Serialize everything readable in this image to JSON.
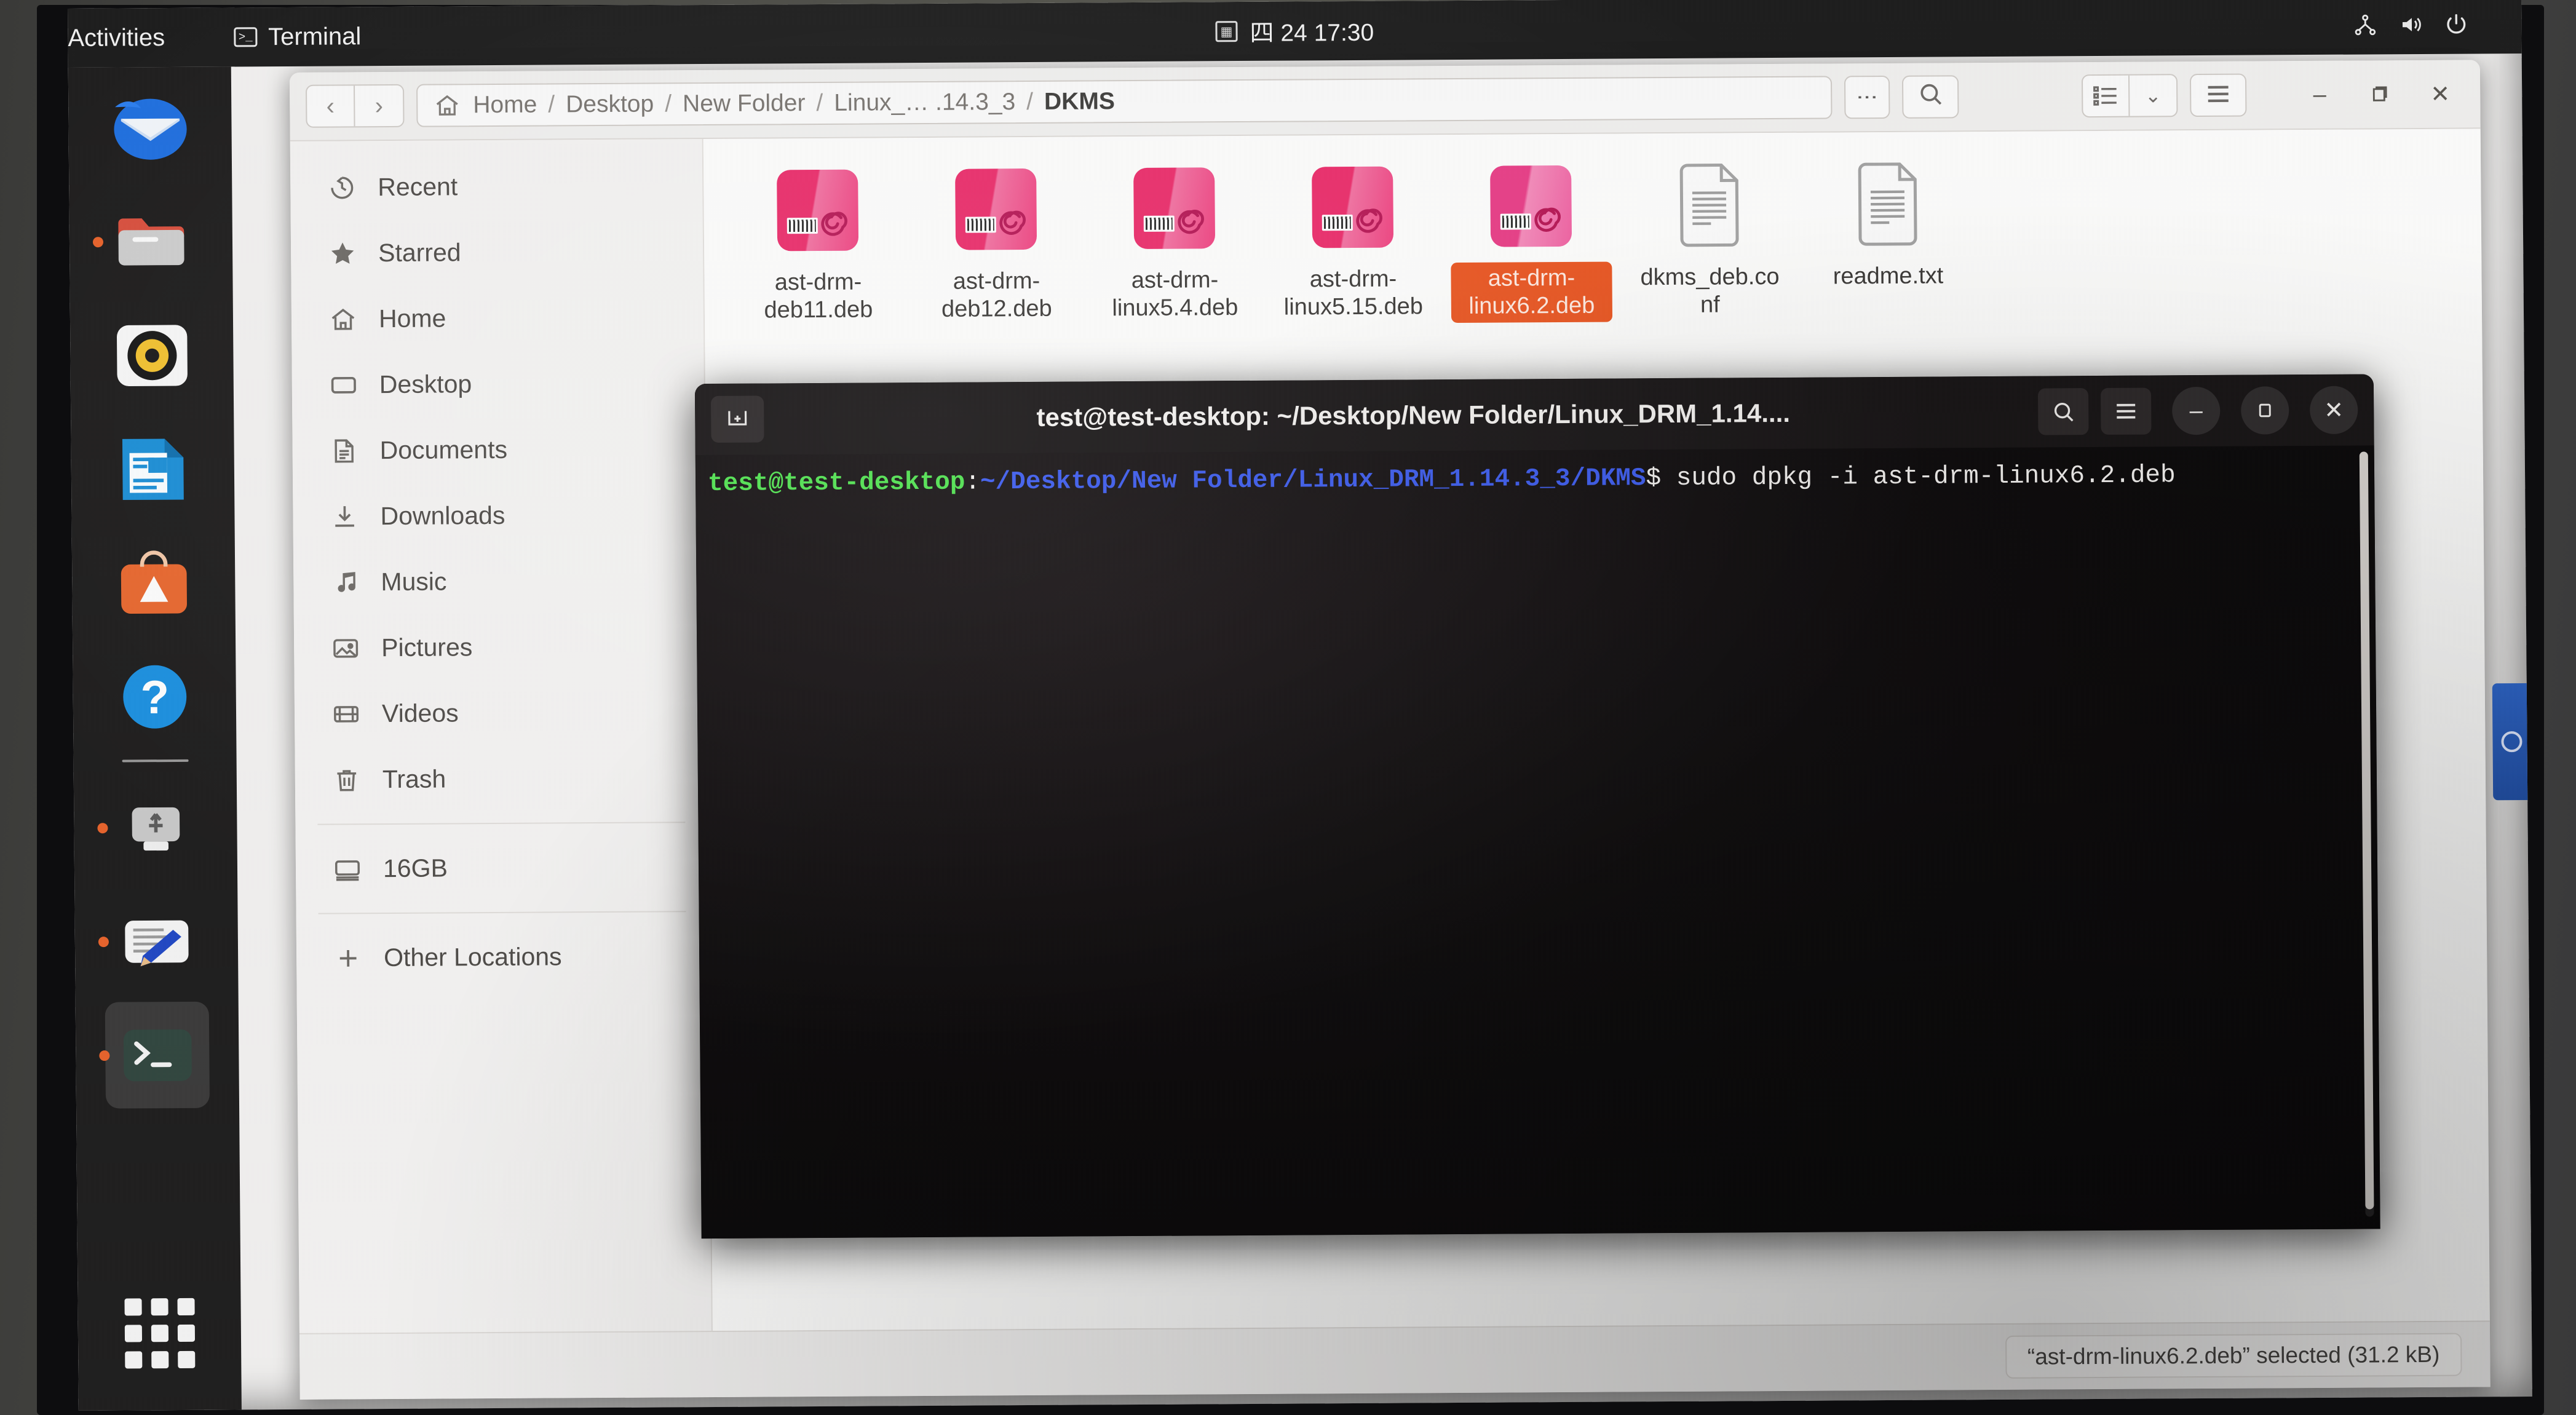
{
  "topbar": {
    "activities": "Activities",
    "app_name": "Terminal",
    "app_icon": "terminal-icon",
    "clock_icon": "calendar-icon",
    "clock": "四 24  17:30",
    "status_icons": [
      "network-icon",
      "volume-icon",
      "power-icon"
    ]
  },
  "dock": {
    "items": [
      {
        "name": "thunderbird",
        "label": "Thunderbird Mail",
        "running": false
      },
      {
        "name": "files",
        "label": "Files",
        "running": true
      },
      {
        "name": "rhythmbox",
        "label": "Rhythmbox",
        "running": false
      },
      {
        "name": "libreoffice-writer",
        "label": "LibreOffice Writer",
        "running": false
      },
      {
        "name": "ubuntu-software",
        "label": "Ubuntu Software",
        "running": false
      },
      {
        "name": "help",
        "label": "Help",
        "running": false
      },
      {
        "name": "usb-drive",
        "label": "16GB Volume",
        "running": true
      },
      {
        "name": "text-editor",
        "label": "Text Editor",
        "running": true
      },
      {
        "name": "terminal",
        "label": "Terminal",
        "running": true
      }
    ],
    "show_apps_label": "Show Applications"
  },
  "files_window": {
    "nav": {
      "back": "‹",
      "forward": "›"
    },
    "breadcrumb": [
      {
        "label": "Home",
        "icon": "home-icon"
      },
      {
        "label": "Desktop",
        "icon": ""
      },
      {
        "label": "New Folder",
        "icon": ""
      },
      {
        "label": "Linux_… .14.3_3",
        "icon": ""
      },
      {
        "label": "DKMS",
        "icon": ""
      }
    ],
    "breadcrumb_separator": "/",
    "buttons": {
      "path_menu": "⋮",
      "search": "search-icon",
      "view_list": "list-view-icon",
      "view_dropdown": "⌄",
      "hamburger": "☰",
      "minimize": "–",
      "maximize": "❐",
      "close": "✕"
    },
    "sidebar": [
      {
        "label": "Recent",
        "icon": "clock-icon"
      },
      {
        "label": "Starred",
        "icon": "star-icon"
      },
      {
        "label": "Home",
        "icon": "home-icon"
      },
      {
        "label": "Desktop",
        "icon": "desktop-icon"
      },
      {
        "label": "Documents",
        "icon": "document-icon"
      },
      {
        "label": "Downloads",
        "icon": "download-icon"
      },
      {
        "label": "Music",
        "icon": "music-icon"
      },
      {
        "label": "Pictures",
        "icon": "picture-icon"
      },
      {
        "label": "Videos",
        "icon": "video-icon"
      },
      {
        "label": "Trash",
        "icon": "trash-icon"
      },
      {
        "label": "16GB",
        "icon": "drive-icon"
      },
      {
        "label": "Other Locations",
        "icon": "plus-icon"
      }
    ],
    "files": [
      {
        "name": "ast-drm-deb11.deb",
        "type": "deb",
        "selected": false
      },
      {
        "name": "ast-drm-deb12.deb",
        "type": "deb",
        "selected": false
      },
      {
        "name": "ast-drm-linux5.4.deb",
        "type": "deb",
        "selected": false
      },
      {
        "name": "ast-drm-linux5.15.deb",
        "type": "deb",
        "selected": false
      },
      {
        "name": "ast-drm-linux6.2.deb",
        "type": "deb",
        "selected": true
      },
      {
        "name": "dkms_deb.conf",
        "type": "text",
        "selected": false
      },
      {
        "name": "readme.txt",
        "type": "text",
        "selected": false
      }
    ],
    "status": "“ast-drm-linux6.2.deb” selected  (31.2 kB)",
    "selection_color": "#e9541f"
  },
  "terminal": {
    "title": "test@test-desktop: ~/Desktop/New Folder/Linux_DRM_1.14....",
    "new_tab_icon": "new-tab-icon",
    "buttons": {
      "search": "search-icon",
      "menu": "☰",
      "minimize": "–",
      "maximize": "❐",
      "close": "✕"
    },
    "prompt_user": "test@test-desktop",
    "prompt_colon": ":",
    "prompt_path": "~/Desktop/New Folder/Linux_DRM_1.14.3_3/DKMS",
    "prompt_sigil": "$",
    "command": " sudo dpkg -i ast-drm-linux6.2.deb",
    "colors": {
      "user": "#4ee24e",
      "path": "#3b5bf0",
      "text": "#f6f4f2",
      "background": "#0a0809"
    }
  }
}
